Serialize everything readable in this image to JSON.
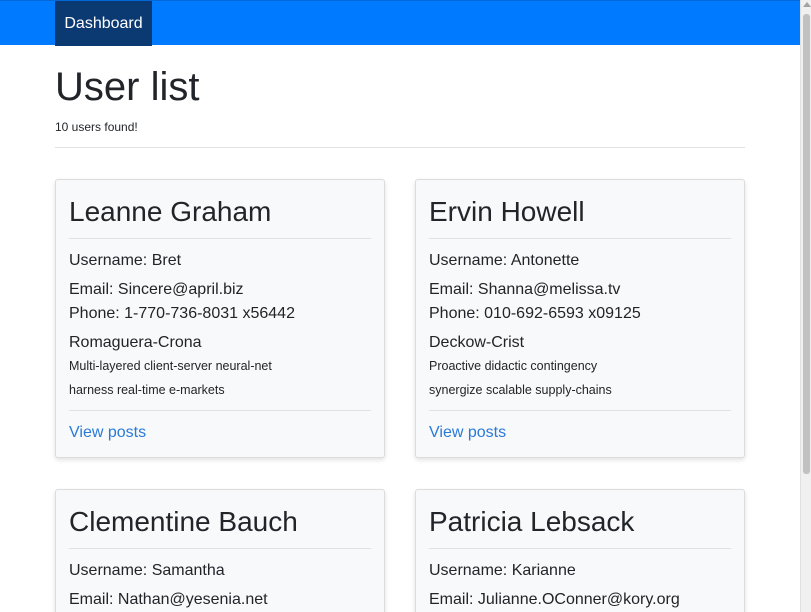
{
  "navbar": {
    "brand": "Dashboard"
  },
  "page": {
    "title": "User list",
    "subtitle": "10 users found!"
  },
  "users": [
    {
      "name": "Leanne Graham",
      "username": "Username: Bret",
      "email": "Email: Sincere@april.biz",
      "phone": "Phone: 1-770-736-8031 x56442",
      "company": "Romaguera-Crona",
      "catch_phrase": "Multi-layered client-server neural-net",
      "bs": "harness real-time e-markets",
      "link": "View posts"
    },
    {
      "name": "Ervin Howell",
      "username": "Username: Antonette",
      "email": "Email: Shanna@melissa.tv",
      "phone": "Phone: 010-692-6593 x09125",
      "company": "Deckow-Crist",
      "catch_phrase": "Proactive didactic contingency",
      "bs": "synergize scalable supply-chains",
      "link": "View posts"
    },
    {
      "name": "Clementine Bauch",
      "username": "Username: Samantha",
      "email": "Email: Nathan@yesenia.net"
    },
    {
      "name": "Patricia Lebsack",
      "username": "Username: Karianne",
      "email": "Email: Julianne.OConner@kory.org"
    }
  ]
}
